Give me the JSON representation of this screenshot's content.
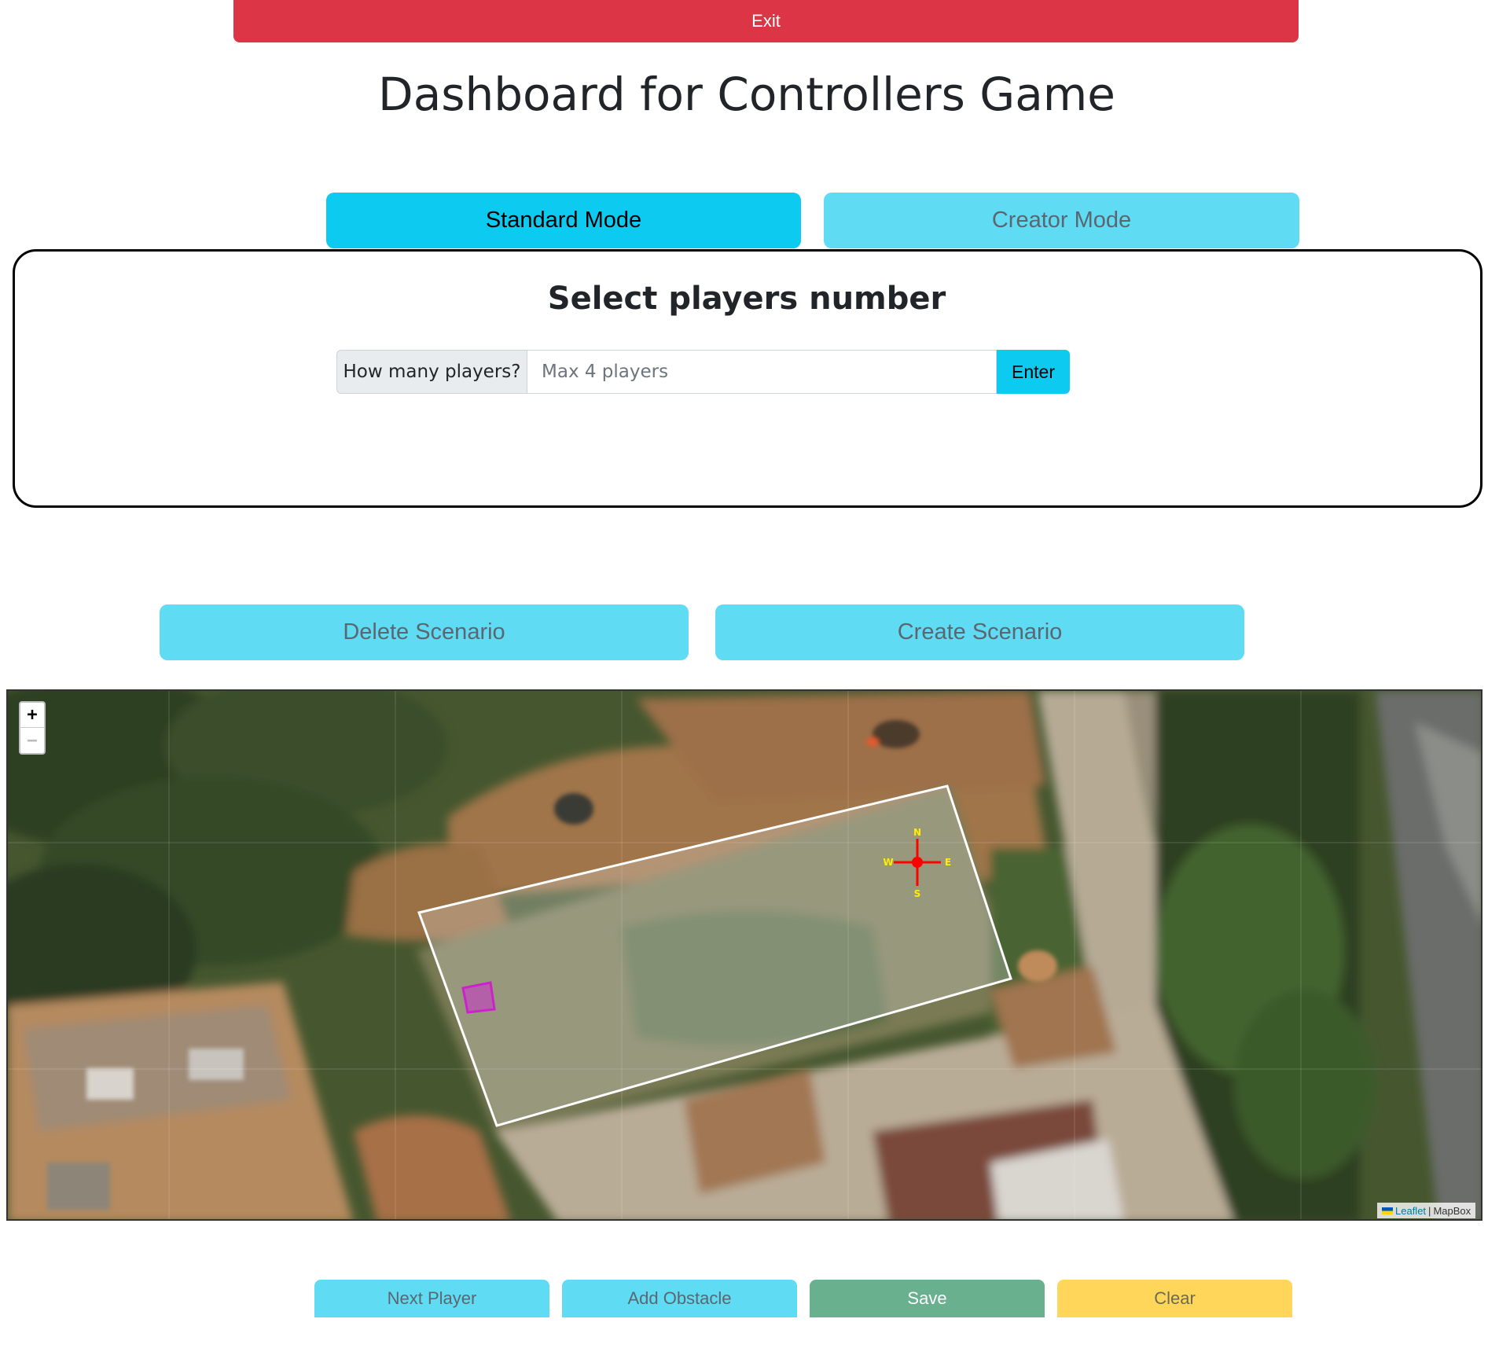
{
  "header": {
    "exit_label": "Exit",
    "title": "Dashboard for Controllers Game"
  },
  "modes": {
    "standard_label": "Standard Mode",
    "creator_label": "Creator Mode",
    "active": "Standard Mode"
  },
  "players": {
    "heading": "Select players number",
    "input_label": "How many players?",
    "input_placeholder": "Max 4 players",
    "input_value": "",
    "enter_label": "Enter"
  },
  "scenario": {
    "delete_label": "Delete Scenario",
    "create_label": "Create Scenario"
  },
  "map": {
    "zoom_in_label": "+",
    "zoom_out_label": "−",
    "attribution_leaflet": "Leaflet",
    "attribution_separator": "|",
    "attribution_provider": "MapBox",
    "compass": {
      "n": "N",
      "s": "S",
      "e": "E",
      "w": "W"
    },
    "field_outline_color": "#ffffff",
    "obstacle_color": "#cc33cc",
    "compass_color": "#ff0000"
  },
  "actions": {
    "next_player_label": "Next Player",
    "add_obstacle_label": "Add Obstacle",
    "save_label": "Save",
    "clear_label": "Clear"
  },
  "colors": {
    "exit": "#dc3545",
    "primary_info": "#0dcaf0",
    "light_info": "#5fdcf3",
    "save": "#69b08e",
    "clear": "#ffd65a"
  }
}
